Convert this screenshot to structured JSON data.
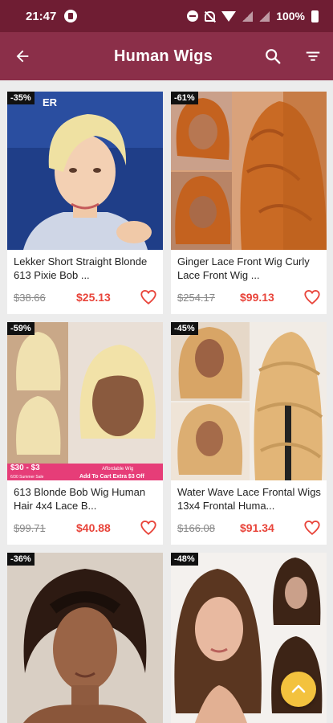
{
  "status_bar": {
    "time": "21:47",
    "battery": "100%"
  },
  "app_bar": {
    "title": "Human Wigs"
  },
  "products": [
    {
      "discount": "-35%",
      "title": "Lekker Short Straight Blonde 613 Pixie Bob ...",
      "old_price": "$38.66",
      "new_price": "$25.13",
      "logo_text": "ER"
    },
    {
      "discount": "-61%",
      "title": "Ginger Lace Front Wig Curly Lace Front Wig ...",
      "old_price": "$254.17",
      "new_price": "$99.13"
    },
    {
      "discount": "-59%",
      "title": "613 Blonde Bob Wig Human Hair 4x4 Lace B...",
      "old_price": "$99.71",
      "new_price": "$40.88",
      "banner_left": "$30 - $3",
      "banner_tag": "Affordable Wig",
      "banner_small": "6/30 Summer Sale",
      "banner_cart": "Add To Cart Extra $3 Off"
    },
    {
      "discount": "-45%",
      "title": "Water Wave Lace Frontal Wigs 13x4 Frontal Huma...",
      "old_price": "$166.08",
      "new_price": "$91.34"
    },
    {
      "discount": "-36%"
    },
    {
      "discount": "-48%"
    }
  ],
  "colors": {
    "status_bar": "#6f1d33",
    "app_bar": "#8b2f49",
    "price": "#e8443a",
    "fab": "#f3c23e"
  }
}
